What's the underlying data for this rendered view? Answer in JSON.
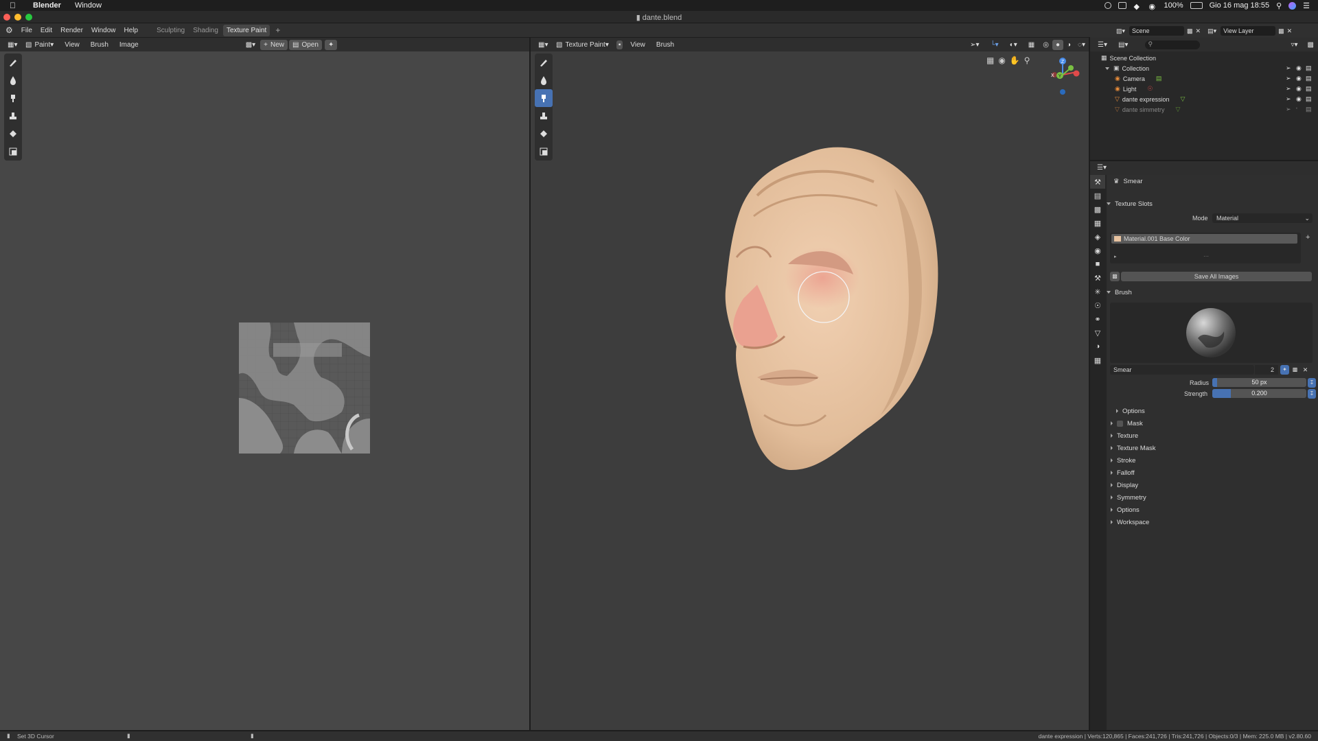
{
  "mac_menubar": {
    "app": "Blender",
    "window_menu": "Window",
    "battery": "100%",
    "datetime": "Gio 16 mag  18:55"
  },
  "window": {
    "title": "dante.blend"
  },
  "topbar": {
    "menus": [
      "File",
      "Edit",
      "Render",
      "Window",
      "Help"
    ],
    "workspaces": [
      "Sculpting",
      "Shading",
      "Texture Paint"
    ],
    "active_workspace": "Texture Paint",
    "add_symbol": "+"
  },
  "image_editor": {
    "mode": "Paint",
    "menus": [
      "View",
      "Brush",
      "Image"
    ],
    "new_label": "New",
    "open_label": "Open"
  },
  "viewport": {
    "mode": "Texture Paint",
    "menus": [
      "View",
      "Brush"
    ],
    "gizmo": {
      "z": "Z",
      "y": "Y",
      "x": "X"
    }
  },
  "outliner": {
    "scene_label": "Scene",
    "view_layer_label": "View Layer",
    "root": "Scene Collection",
    "items": [
      {
        "name": "Collection",
        "kind": "collection"
      },
      {
        "name": "Camera",
        "kind": "camera"
      },
      {
        "name": "Light",
        "kind": "light"
      },
      {
        "name": "dante expression",
        "kind": "mesh"
      },
      {
        "name": "dante simmetry",
        "kind": "mesh-dim"
      }
    ]
  },
  "properties": {
    "active_tool": "Smear",
    "texture_slots": {
      "title": "Texture Slots",
      "mode_label": "Mode",
      "mode_value": "Material",
      "slot": "Material.001 Base Color",
      "save_all": "Save All Images"
    },
    "brush": {
      "title": "Brush",
      "name": "Smear",
      "users": "2",
      "radius_label": "Radius",
      "radius_value": "50 px",
      "radius_fraction": 0.05,
      "strength_label": "Strength",
      "strength_value": "0.200",
      "strength_fraction": 0.2
    },
    "subpanels": [
      "Options",
      "Mask",
      "Texture",
      "Texture Mask",
      "Stroke",
      "Falloff",
      "Display",
      "Symmetry",
      "Options",
      "Workspace"
    ]
  },
  "statusbar": {
    "left": "Set 3D Cursor",
    "right": "dante expression | Verts:120,865 | Faces:241,726 | Tris:241,726 | Objects:0/3 | Mem: 225.0 MB | v2.80.60"
  },
  "colors": {
    "accent": "#4772b3",
    "skin": "#e8c3a0"
  }
}
